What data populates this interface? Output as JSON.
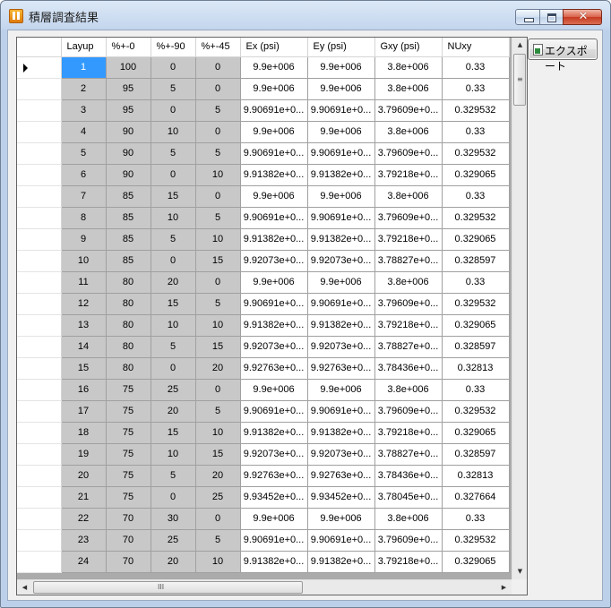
{
  "window": {
    "title": "積層調査結果",
    "close_glyph": "✕"
  },
  "toolbar": {
    "export_label": "エクスポート"
  },
  "grid": {
    "columns": [
      "Layup",
      "%+-0",
      "%+-90",
      "%+-45",
      "Ex (psi)",
      "Ey (psi)",
      "Gxy (psi)",
      "NUxy"
    ],
    "rows": [
      [
        "1",
        "100",
        "0",
        "0",
        "9.9e+006",
        "9.9e+006",
        "3.8e+006",
        "0.33"
      ],
      [
        "2",
        "95",
        "5",
        "0",
        "9.9e+006",
        "9.9e+006",
        "3.8e+006",
        "0.33"
      ],
      [
        "3",
        "95",
        "0",
        "5",
        "9.90691e+0...",
        "9.90691e+0...",
        "3.79609e+0...",
        "0.329532"
      ],
      [
        "4",
        "90",
        "10",
        "0",
        "9.9e+006",
        "9.9e+006",
        "3.8e+006",
        "0.33"
      ],
      [
        "5",
        "90",
        "5",
        "5",
        "9.90691e+0...",
        "9.90691e+0...",
        "3.79609e+0...",
        "0.329532"
      ],
      [
        "6",
        "90",
        "0",
        "10",
        "9.91382e+0...",
        "9.91382e+0...",
        "3.79218e+0...",
        "0.329065"
      ],
      [
        "7",
        "85",
        "15",
        "0",
        "9.9e+006",
        "9.9e+006",
        "3.8e+006",
        "0.33"
      ],
      [
        "8",
        "85",
        "10",
        "5",
        "9.90691e+0...",
        "9.90691e+0...",
        "3.79609e+0...",
        "0.329532"
      ],
      [
        "9",
        "85",
        "5",
        "10",
        "9.91382e+0...",
        "9.91382e+0...",
        "3.79218e+0...",
        "0.329065"
      ],
      [
        "10",
        "85",
        "0",
        "15",
        "9.92073e+0...",
        "9.92073e+0...",
        "3.78827e+0...",
        "0.328597"
      ],
      [
        "11",
        "80",
        "20",
        "0",
        "9.9e+006",
        "9.9e+006",
        "3.8e+006",
        "0.33"
      ],
      [
        "12",
        "80",
        "15",
        "5",
        "9.90691e+0...",
        "9.90691e+0...",
        "3.79609e+0...",
        "0.329532"
      ],
      [
        "13",
        "80",
        "10",
        "10",
        "9.91382e+0...",
        "9.91382e+0...",
        "3.79218e+0...",
        "0.329065"
      ],
      [
        "14",
        "80",
        "5",
        "15",
        "9.92073e+0...",
        "9.92073e+0...",
        "3.78827e+0...",
        "0.328597"
      ],
      [
        "15",
        "80",
        "0",
        "20",
        "9.92763e+0...",
        "9.92763e+0...",
        "3.78436e+0...",
        "0.32813"
      ],
      [
        "16",
        "75",
        "25",
        "0",
        "9.9e+006",
        "9.9e+006",
        "3.8e+006",
        "0.33"
      ],
      [
        "17",
        "75",
        "20",
        "5",
        "9.90691e+0...",
        "9.90691e+0...",
        "3.79609e+0...",
        "0.329532"
      ],
      [
        "18",
        "75",
        "15",
        "10",
        "9.91382e+0...",
        "9.91382e+0...",
        "3.79218e+0...",
        "0.329065"
      ],
      [
        "19",
        "75",
        "10",
        "15",
        "9.92073e+0...",
        "9.92073e+0...",
        "3.78827e+0...",
        "0.328597"
      ],
      [
        "20",
        "75",
        "5",
        "20",
        "9.92763e+0...",
        "9.92763e+0...",
        "3.78436e+0...",
        "0.32813"
      ],
      [
        "21",
        "75",
        "0",
        "25",
        "9.93452e+0...",
        "9.93452e+0...",
        "3.78045e+0...",
        "0.327664"
      ],
      [
        "22",
        "70",
        "30",
        "0",
        "9.9e+006",
        "9.9e+006",
        "3.8e+006",
        "0.33"
      ],
      [
        "23",
        "70",
        "25",
        "5",
        "9.90691e+0...",
        "9.90691e+0...",
        "3.79609e+0...",
        "0.329532"
      ],
      [
        "24",
        "70",
        "20",
        "10",
        "9.91382e+0...",
        "9.91382e+0...",
        "3.79218e+0...",
        "0.329065"
      ]
    ]
  },
  "scrollbars": {
    "grip": "≡",
    "h_grip": "III",
    "up": "▲",
    "down": "▼",
    "left": "◀",
    "right": "▶"
  }
}
